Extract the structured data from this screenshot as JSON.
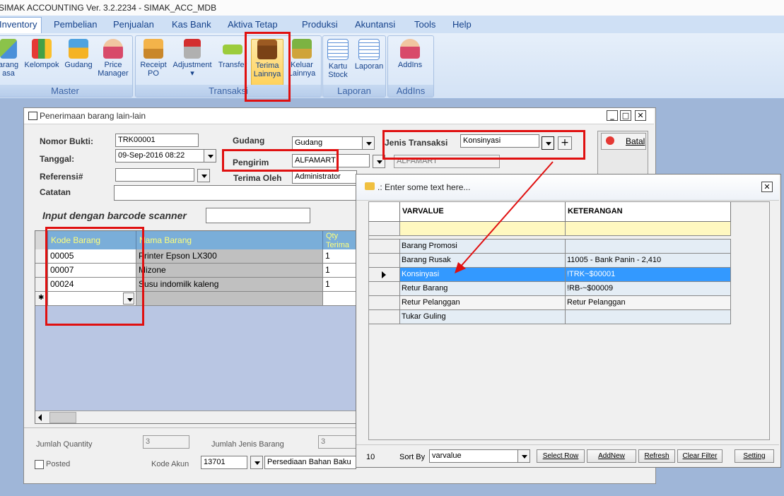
{
  "window_title": "SIMAK ACCOUNTING Ver. 3.2.2234 - SIMAK_ACC_MDB",
  "menu": [
    "Inventory",
    "Pembelian",
    "Penjualan",
    "Kas Bank",
    "Aktiva Tetap",
    "Produksi",
    "Akuntansi",
    "Tools",
    "Help"
  ],
  "ribbon": {
    "master": {
      "caption": "Master",
      "buttons": [
        {
          "l1": "arang",
          "l2": "asa"
        },
        {
          "l1": "Kelompok",
          "l2": ""
        },
        {
          "l1": "Gudang",
          "l2": ""
        },
        {
          "l1": "Price",
          "l2": "Manager"
        }
      ]
    },
    "transaksi": {
      "caption": "Transaksi",
      "buttons": [
        {
          "l1": "Receipt",
          "l2": "PO"
        },
        {
          "l1": "Adjustment",
          "l2": "▾"
        },
        {
          "l1": "Transfer",
          "l2": ""
        },
        {
          "l1": "Terima",
          "l2": "Lainnya"
        },
        {
          "l1": "Keluar",
          "l2": "Lainnya"
        }
      ]
    },
    "laporan": {
      "caption": "Laporan",
      "buttons": [
        {
          "l1": "Kartu",
          "l2": "Stock"
        },
        {
          "l1": "Laporan",
          "l2": ""
        }
      ]
    },
    "addins": {
      "caption": "AddIns",
      "buttons": [
        {
          "l1": "AddIns",
          "l2": ""
        }
      ]
    }
  },
  "form": {
    "title": "Penerimaan barang lain-lain",
    "nomor_bukti_label": "Nomor Bukti:",
    "nomor_bukti": "TRK00001",
    "tanggal_label": "Tanggal:",
    "tanggal": "09-Sep-2016 08:22",
    "referensi_label": "Referensi#",
    "referensi": "",
    "catatan_label": "Catatan",
    "catatan": "",
    "gudang_label": "Gudang",
    "gudang": "Gudang",
    "pengirim_label": "Pengirim",
    "pengirim": "ALFAMART",
    "pengirim_name": "ALFAMART",
    "terima_oleh_label": "Terima Oleh",
    "terima_oleh": "Administrator",
    "jenis_transaksi_label": "Jenis Transaksi",
    "jenis_transaksi": "Konsinyasi",
    "add_symbol": "+",
    "batal_label": "Batal",
    "barcode_label": "Input dengan barcode scanner",
    "barcode": "",
    "grid_headers": [
      "Kode Barang",
      "Nama Barang",
      "Qty Terima"
    ],
    "items": [
      {
        "kode": "00005",
        "nama": "Printer Epson LX300",
        "qty": "1"
      },
      {
        "kode": "00007",
        "nama": "Mizone",
        "qty": "1"
      },
      {
        "kode": "00024",
        "nama": "Susu indomilk kaleng",
        "qty": "1"
      }
    ],
    "new_row_marker": "✱",
    "jumlah_qty_label": "Jumlah Quantity",
    "jumlah_qty": "3",
    "jumlah_jenis_label": "Jumlah Jenis Barang",
    "jumlah_jenis": "3",
    "posted_label": "Posted",
    "kode_akun_label": "Kode Akun",
    "kode_akun": "13701",
    "kode_akun_name": "Persediaan Bahan Baku"
  },
  "popup": {
    "title": ".: Enter some text here...",
    "headers": [
      "VARVALUE",
      "KETERANGAN"
    ],
    "rows": [
      {
        "var": "Barang Promosi",
        "ket": ""
      },
      {
        "var": "Barang Rusak",
        "ket": "11005 - Bank Panin - 2,410"
      },
      {
        "var": "Konsinyasi",
        "ket": "!TRK~$00001"
      },
      {
        "var": "Retur Barang",
        "ket": "!RB-~$00009"
      },
      {
        "var": "Retur Pelanggan",
        "ket": "Retur Pelanggan"
      },
      {
        "var": "Tukar Guling",
        "ket": ""
      }
    ],
    "count": "10",
    "sort_by_label": "Sort By",
    "sort_by": "varvalue",
    "buttons": [
      "Select Row",
      "AddNew",
      "Refresh",
      "Clear Filter",
      "Setting"
    ]
  },
  "colors": {
    "annotation_red": "#e01010",
    "grid_header": "#7aaed9",
    "selected_row": "#3399ff",
    "filter_row": "#fff8c0"
  }
}
